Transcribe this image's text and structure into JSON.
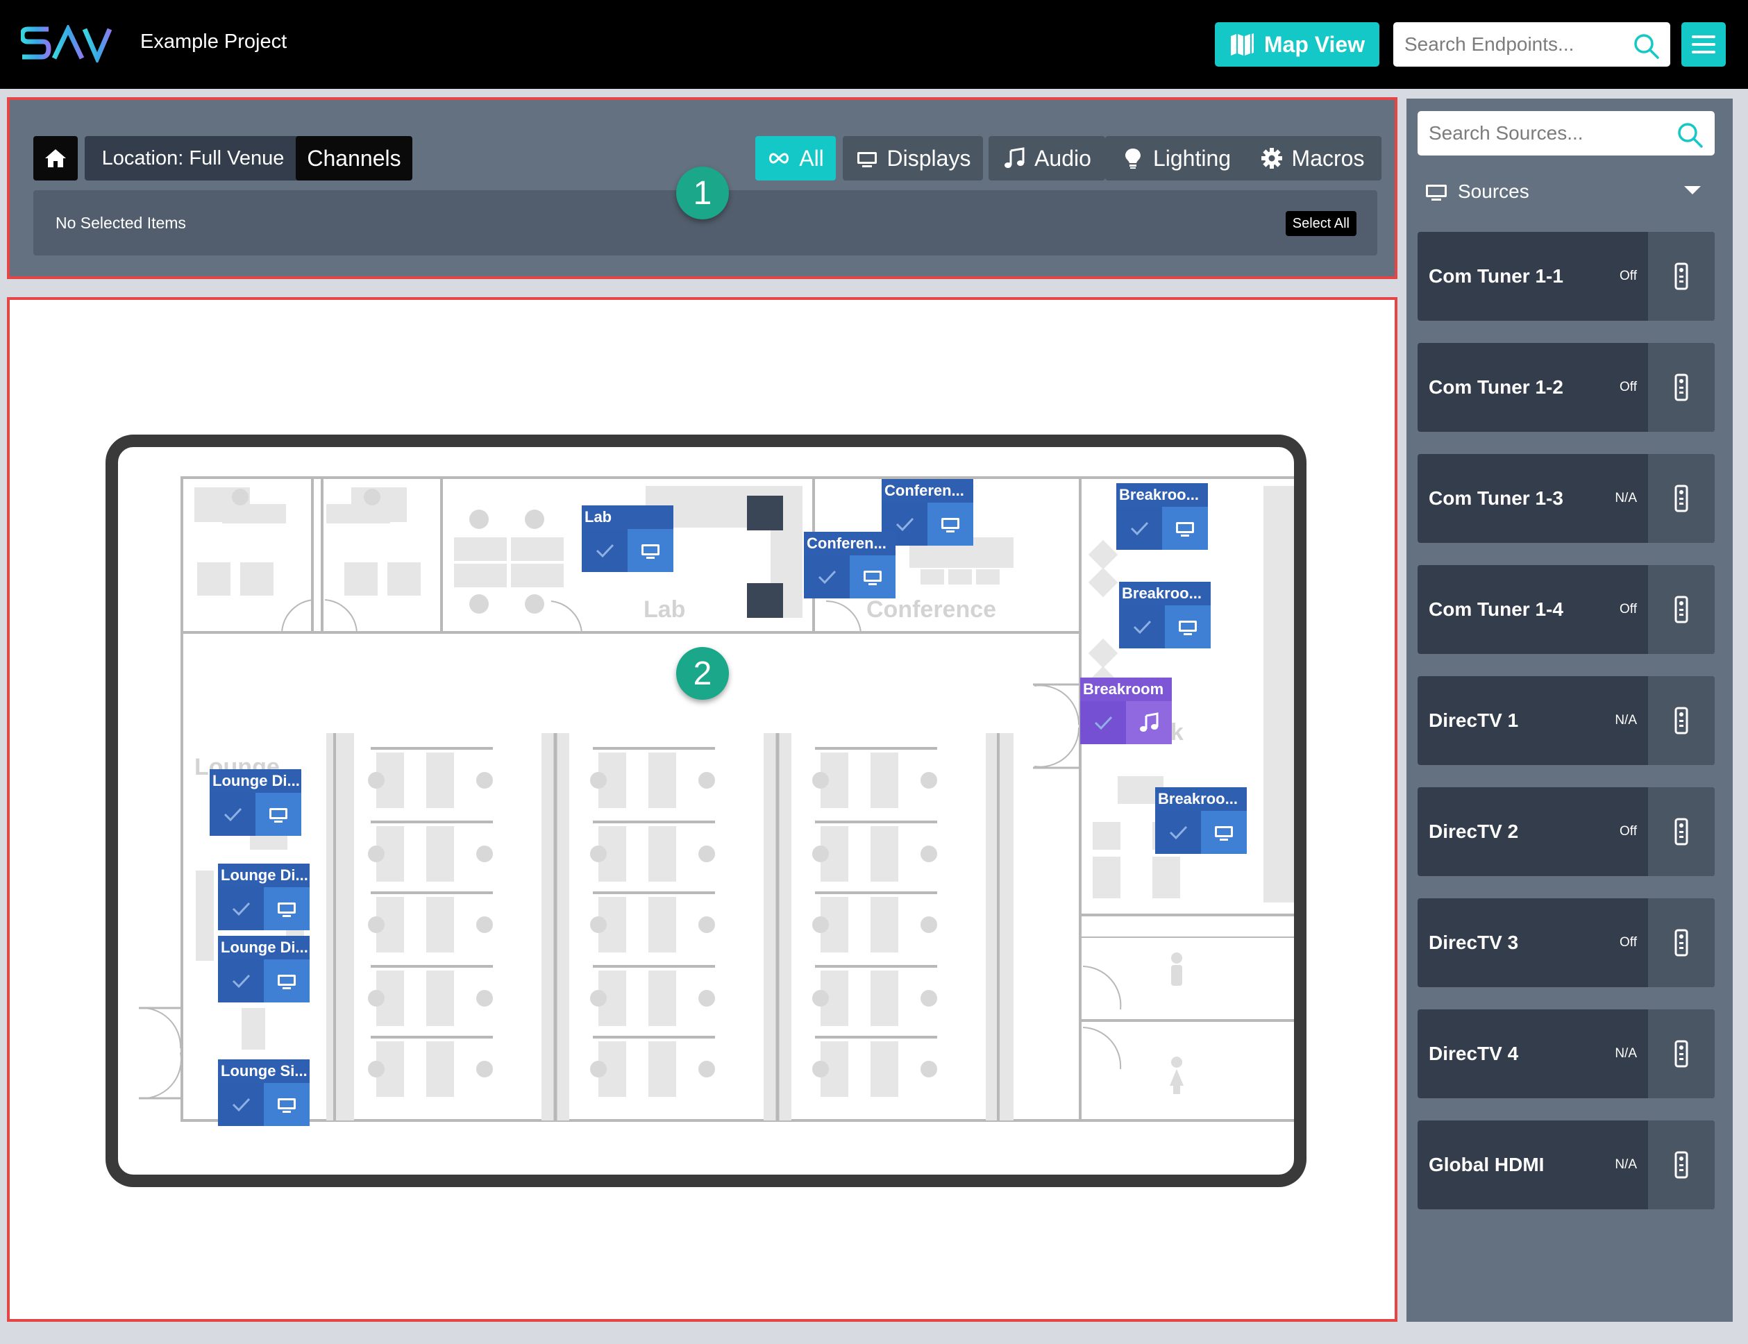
{
  "header": {
    "logo_text": "SAVI",
    "project_name": "Example Project",
    "map_view_label": "Map View",
    "search_placeholder": "Search Endpoints..."
  },
  "control_panel": {
    "location_label": "Location: Full Venue",
    "channels_label": "Channels",
    "filters": {
      "all": "All",
      "displays": "Displays",
      "audio": "Audio",
      "lighting": "Lighting",
      "macros": "Macros"
    },
    "selection_text": "No Selected Items",
    "select_all_label": "Select All",
    "badge": "1"
  },
  "map": {
    "badge": "2",
    "room_labels": {
      "lab": "Lab",
      "conference": "Conference",
      "break": "ak",
      "lounge": "Lounge"
    },
    "endpoints": [
      {
        "name": "Lab",
        "type": "display"
      },
      {
        "name": "Conferen...",
        "type": "display"
      },
      {
        "name": "Conferen...",
        "type": "display"
      },
      {
        "name": "Breakroo...",
        "type": "display"
      },
      {
        "name": "Breakroo...",
        "type": "display"
      },
      {
        "name": "Breakroom",
        "type": "audio"
      },
      {
        "name": "Breakroo...",
        "type": "display"
      },
      {
        "name": "Lounge Di...",
        "type": "display"
      },
      {
        "name": "Lounge Di...",
        "type": "display"
      },
      {
        "name": "Lounge Di...",
        "type": "display"
      },
      {
        "name": "Lounge Si...",
        "type": "display"
      }
    ]
  },
  "sidebar": {
    "search_placeholder": "Search Sources...",
    "header_label": "Sources",
    "sources": [
      {
        "name": "Com Tuner 1-1",
        "status": "Off"
      },
      {
        "name": "Com Tuner 1-2",
        "status": "Off"
      },
      {
        "name": "Com Tuner 1-3",
        "status": "N/A"
      },
      {
        "name": "Com Tuner 1-4",
        "status": "Off"
      },
      {
        "name": "DirecTV 1",
        "status": "N/A"
      },
      {
        "name": "DirecTV 2",
        "status": "Off"
      },
      {
        "name": "DirecTV 3",
        "status": "Off"
      },
      {
        "name": "DirecTV 4",
        "status": "N/A"
      },
      {
        "name": "Global HDMI",
        "status": "N/A"
      }
    ]
  },
  "colors": {
    "accent": "#14c8c8",
    "panel": "#647180",
    "dark_button": "#333d4c",
    "highlight_border": "#e64545",
    "badge": "#1aa78a",
    "display_endpoint": "#2f5fb0",
    "audio_endpoint": "#7d56d6"
  },
  "icons": [
    "logo",
    "map-view-icon",
    "search-icon",
    "menu-icon",
    "home-icon",
    "infinity-icon",
    "display-icon",
    "music-note-icon",
    "lightbulb-icon",
    "gear-icon",
    "check-icon",
    "remote-icon",
    "caret-down-icon"
  ]
}
